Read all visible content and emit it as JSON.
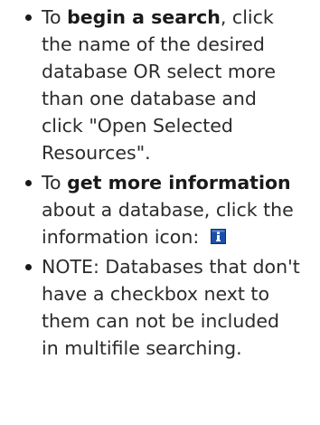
{
  "instructions": [
    {
      "lines": [
        [
          "To ",
          "begin a search",
          ", click"
        ],
        [
          "the name of the desired"
        ],
        [
          "database OR select more"
        ],
        [
          "than one database and"
        ],
        [
          "click \"Open Selected"
        ],
        [
          "Resources\"."
        ]
      ]
    },
    {
      "lines": [
        [
          "To ",
          "get more information"
        ],
        [
          "about a database, click the"
        ],
        [
          "information icon: "
        ]
      ],
      "icon": "info-icon",
      "icon_color": "#1c4fa8"
    },
    {
      "lines": [
        [
          "NOTE: Databases that don't"
        ],
        [
          "have a checkbox next to"
        ],
        [
          "them can not be included"
        ],
        [
          "in multifile searching."
        ]
      ]
    }
  ]
}
